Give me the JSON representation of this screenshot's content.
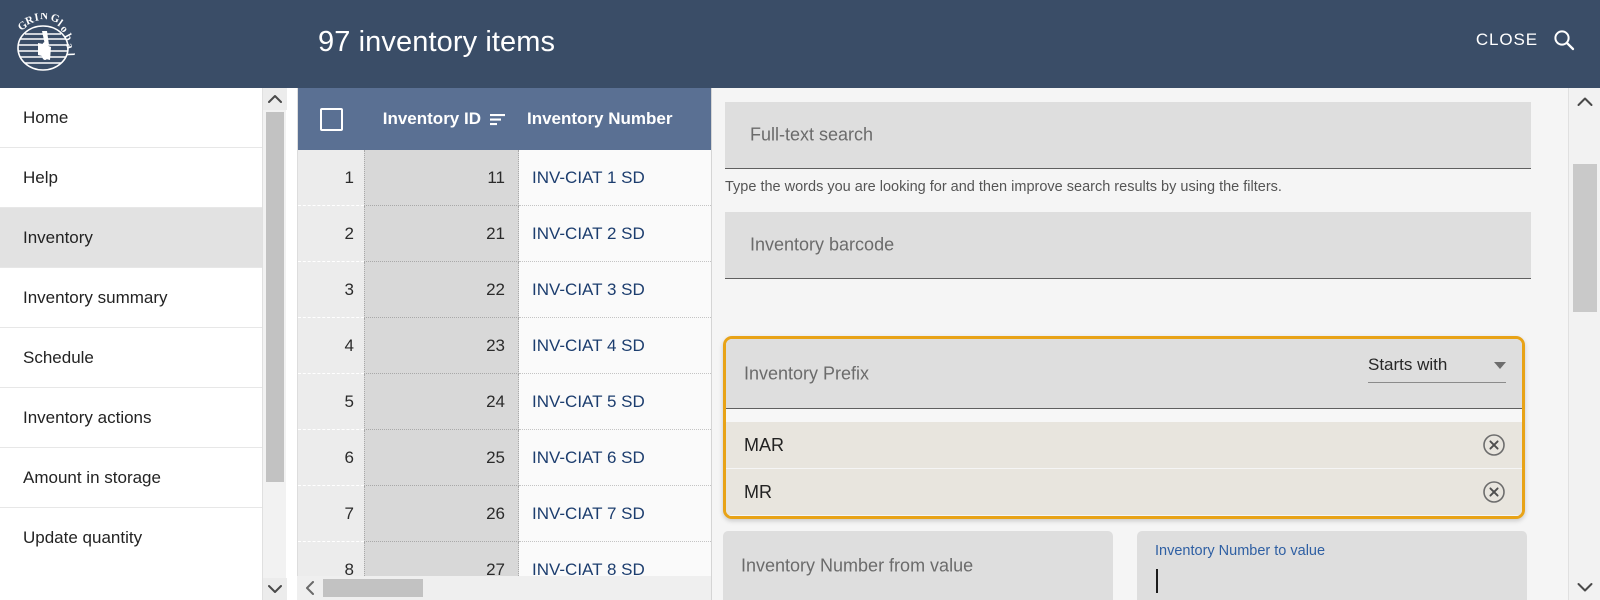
{
  "topbar": {
    "logo_text": "GRIN-Global",
    "logo_icon": "grin-global-globe-logo",
    "title": "97 inventory items",
    "close_label": "CLOSE",
    "search_icon": "search-icon",
    "bg_color": "#3a4d67"
  },
  "sidebar": {
    "items": [
      {
        "label": "Home",
        "active": false
      },
      {
        "label": "Help",
        "active": false
      },
      {
        "label": "Inventory",
        "active": true
      },
      {
        "label": "Inventory summary",
        "active": false
      },
      {
        "label": "Schedule",
        "active": false
      },
      {
        "label": "Inventory actions",
        "active": false
      },
      {
        "label": "Amount in storage",
        "active": false
      },
      {
        "label": "Update quantity",
        "active": false
      }
    ],
    "scrollbar": {
      "up_icon": "chevron-up-icon",
      "down_icon": "chevron-down-icon"
    }
  },
  "table": {
    "header_bg": "#5a7093",
    "select_all_icon": "checkbox-unchecked-icon",
    "columns": [
      {
        "key": "row_number",
        "label": ""
      },
      {
        "key": "inventory_id",
        "label": "Inventory ID",
        "sort_icon": "sort-descending-icon"
      },
      {
        "key": "inventory_number",
        "label": "Inventory Number"
      }
    ],
    "rows": [
      {
        "row_number": "1",
        "inventory_id": "11",
        "inventory_number": "INV-CIAT 1 SD"
      },
      {
        "row_number": "2",
        "inventory_id": "21",
        "inventory_number": "INV-CIAT 2 SD"
      },
      {
        "row_number": "3",
        "inventory_id": "22",
        "inventory_number": "INV-CIAT 3 SD"
      },
      {
        "row_number": "4",
        "inventory_id": "23",
        "inventory_number": "INV-CIAT 4 SD"
      },
      {
        "row_number": "5",
        "inventory_id": "24",
        "inventory_number": "INV-CIAT 5 SD"
      },
      {
        "row_number": "6",
        "inventory_id": "25",
        "inventory_number": "INV-CIAT 6 SD"
      },
      {
        "row_number": "7",
        "inventory_id": "26",
        "inventory_number": "INV-CIAT 7 SD"
      },
      {
        "row_number": "8",
        "inventory_id": "27",
        "inventory_number": "INV-CIAT 8 SD"
      }
    ],
    "hscroll": {
      "left_icon": "chevron-left-icon"
    }
  },
  "search_panel": {
    "fulltext": {
      "placeholder": "Full-text search",
      "value": ""
    },
    "helper_text": "Type the words you are looking for and then improve search results by using the filters.",
    "barcode": {
      "placeholder": "Inventory barcode",
      "value": ""
    },
    "prefix_group": {
      "highlighted": true,
      "highlight_color": "#e8a317",
      "placeholder": "Inventory Prefix",
      "value": "",
      "operator": {
        "selected": "Starts with",
        "caret_icon": "chevron-down-icon"
      },
      "chips": [
        {
          "label": "MAR",
          "remove_icon": "circle-x-icon"
        },
        {
          "label": "MR",
          "remove_icon": "circle-x-icon"
        }
      ]
    },
    "number_from": {
      "placeholder": "Inventory Number from value",
      "value": "",
      "focused": false
    },
    "number_to": {
      "label": "Inventory Number to value",
      "value": "",
      "focused": true,
      "label_color": "#2e5fa3"
    },
    "scrollbar": {
      "up_icon": "chevron-up-icon",
      "down_icon": "chevron-down-icon"
    }
  }
}
